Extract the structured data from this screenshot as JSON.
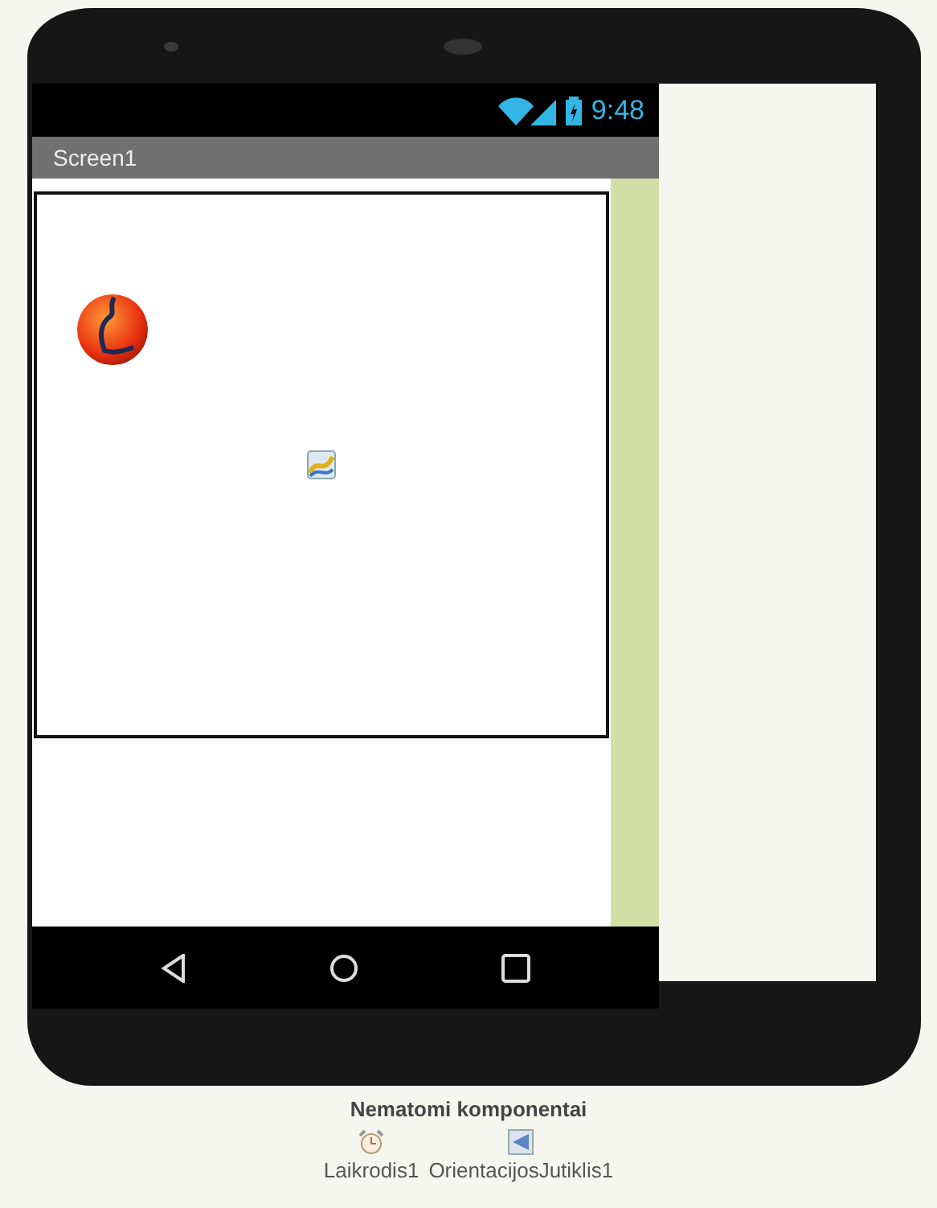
{
  "status_bar": {
    "time": "9:48"
  },
  "title_bar": {
    "title": "Screen1"
  },
  "non_visible_components": {
    "heading": "Nematomi komponentai",
    "items": [
      {
        "kind": "clock",
        "label": "Laikrodis1"
      },
      {
        "kind": "orientation_sensor",
        "label": "OrientacijosJutiklis1"
      }
    ]
  }
}
